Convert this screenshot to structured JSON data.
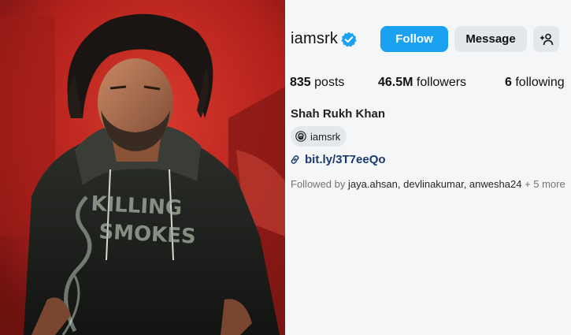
{
  "profile": {
    "username": "iamsrk",
    "full_name": "Shah Rukh Khan",
    "threads_handle": "iamsrk",
    "link_text": "bit.ly/3T7eeQo"
  },
  "buttons": {
    "follow": "Follow",
    "message": "Message"
  },
  "stats": {
    "posts_count": "835",
    "posts_label": "posts",
    "followers_count": "46.5M",
    "followers_label": "followers",
    "following_count": "6",
    "following_label": "following"
  },
  "followed_by": {
    "prefix": "Followed by",
    "names": "jaya.ahsan, devlinakumar, anwesha24",
    "more": "+ 5 more"
  },
  "photo": {
    "shirt_text_line1": "KILLING",
    "shirt_text_line2": "SMOKES"
  },
  "colors": {
    "accent": "#1ba1f2",
    "verified": "#1ba1f2",
    "background": "#f4f6f8",
    "photo_bg": "#b8231f"
  },
  "icons": {
    "verified": "verified-badge-icon",
    "add_user": "add-user-icon",
    "threads": "threads-icon",
    "link": "link-icon"
  }
}
